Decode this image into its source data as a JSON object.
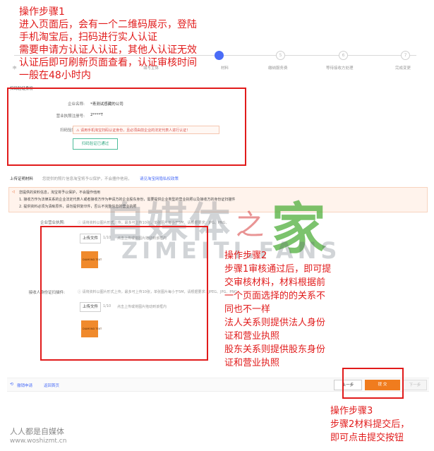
{
  "steps": {
    "items": [
      {
        "num": "",
        "label": "申"
      },
      {
        "num": "",
        "label": "填写主体"
      },
      {
        "num": "",
        "label": "材料"
      },
      {
        "num": "5",
        "label": "缴纳服务费"
      },
      {
        "num": "6",
        "label": "等待接收方处理"
      },
      {
        "num": "7",
        "label": "完成变更"
      }
    ]
  },
  "scan_section": {
    "title": "扫码验证身份",
    "company_label": "企业名称:",
    "company_value": "*青测试感藏的公司",
    "license_label": "营业执照注册号:",
    "license_value": "2****T",
    "scan_label": "扫码验证身份:",
    "warning": "请用手机淘宝扫码认证身份，且必须由前企业的法定代表人进行认证！",
    "verified_button": "扫码验证已通过"
  },
  "upload_section": {
    "title": "上传证明材料",
    "subtitle": "您提供的照片信息淘宝将予以保护，不会擅作他用，",
    "subtitle_link": "请见淘宝网隐私权政策",
    "notice_lines": [
      "您提供的资料信息，淘宝将予以保护，不会擅作他用",
      "1. 接收方作为法律关系的企业法定代表人或者接收方作为申请方的企业股东身份，需要提供企业类型的营业执照以及接收方的身份证扫描件",
      "2. 提供资料必须为清晰原件，请勿提供复印件，否认不完整信息的营业执照"
    ],
    "license_label": "企业营业执照:",
    "license_hint": "请将资料以图片形式上传，最多可上传10张，单张图片每小于5M，请根据要求：JPG、PNG、",
    "upload_label_1": "上传文件",
    "count_1": "1/10",
    "upload_hint_1": "点击上传或将图片拖动到该框内",
    "id_label": "接收人身份证扫描件:",
    "id_hint": "请将资料以图片形式上传，最多可上传10张，单张图片每小于5M，请根据要求：JPEG、JPG、PNG",
    "upload_label_2": "上传文件",
    "count_2": "1/10",
    "upload_hint_2": "点击上传或将图片拖动到该框内",
    "thumb_text": "DIAMOND TEXT"
  },
  "bottom_bar": {
    "revoke": "撤销申请",
    "back_home": "返回首页",
    "prev": "上一步",
    "submit": "提 交",
    "next": "下一步"
  },
  "annotations": {
    "step1_lines": [
      "操作步骤1",
      "进入页面后，会有一个二维码展示，登陆",
      "手机淘宝后，扫码进行实人认证",
      "需要申请方认证人认证，其他人认证无效",
      "认证后即可刷新页面查看，认证审核时间",
      "一般在48小时内"
    ],
    "step2_lines": [
      "操作步骤2",
      "步骤1审核通过后，即可提",
      "交审核材料，材料根据前",
      "一个页面选择的的关系不",
      "同也不一样",
      "法人关系则提供法人身份",
      "证和营业执照",
      "股东关系则提供股东身份",
      "证和营业执照"
    ],
    "step3_lines": [
      "操作步骤3",
      "步骤2材料提交后，",
      "即可点击提交按钮"
    ]
  },
  "watermark": {
    "cn": "自媒体",
    "zhi": "之",
    "jia": "家",
    "en": "ZIMEITI.FANS"
  },
  "footer": {
    "brand": "人人都是自媒体",
    "url": "www.woshizmt.cn"
  },
  "colors": {
    "annotation_red": "#e11b1b",
    "submit_orange": "#f07c1e",
    "step_active": "#4a6cf7",
    "verified_green": "#2ea67f"
  }
}
